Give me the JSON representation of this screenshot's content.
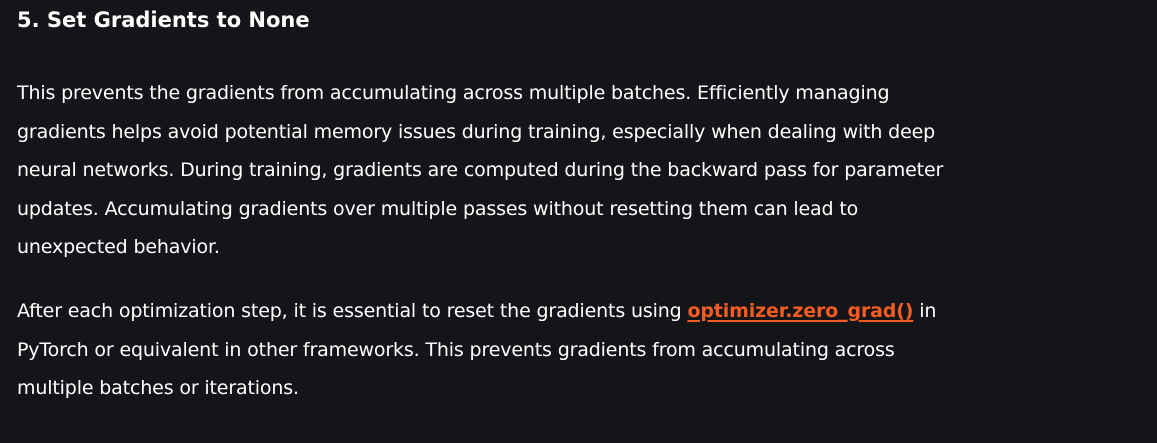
{
  "section": {
    "heading": "5. Set Gradients to None",
    "paragraph1_lines": [
      "This prevents the gradients from accumulating across multiple batches. Efficiently managing",
      "gradients helps avoid potential memory issues during training, especially when dealing with deep",
      "neural networks. During training, gradients are computed during the backward pass for parameter",
      "updates. Accumulating gradients over multiple passes without resetting them can lead to",
      "unexpected behavior."
    ],
    "paragraph2": {
      "line1_before": "After each optimization step, it is essential to reset the gradients using ",
      "link_text": "optimizer.zero_grad()",
      "line1_after": " in",
      "line2": "PyTorch or equivalent in other frameworks. This prevents gradients from accumulating across",
      "line3": "multiple batches or iterations."
    }
  },
  "colors": {
    "background": "#141519",
    "text": "#ffffff",
    "link": "#f25c22"
  }
}
